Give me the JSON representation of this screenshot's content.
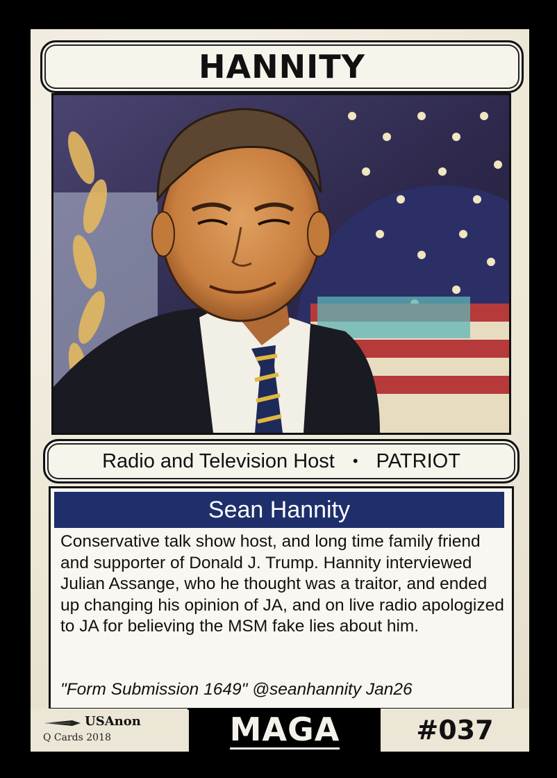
{
  "card": {
    "title": "HANNITY",
    "subtitle_left": "Radio and Television Host",
    "subtitle_separator": "•",
    "subtitle_right": "PATRIOT",
    "name": "Sean Hannity",
    "description": "Conservative talk show host, and long time family friend and supporter of Donald J. Trump. Hannity interviewed Julian Assange, who he thought was a traitor, and ended up changing his opinion of JA, and on live radio apologized to JA for believing the MSM fake lies about him.",
    "quote": "\"Form Submission 1649\" @seanhannity Jan26",
    "brand": "USAnon",
    "brand_sub": "Q Cards 2018",
    "footer_center": "MAGA",
    "card_number": "#037"
  },
  "colors": {
    "name_bar": "#1e2f6b",
    "card_background": "#f1ece0",
    "border": "#000000"
  },
  "icons": {
    "brand_icon": "pen-icon"
  }
}
